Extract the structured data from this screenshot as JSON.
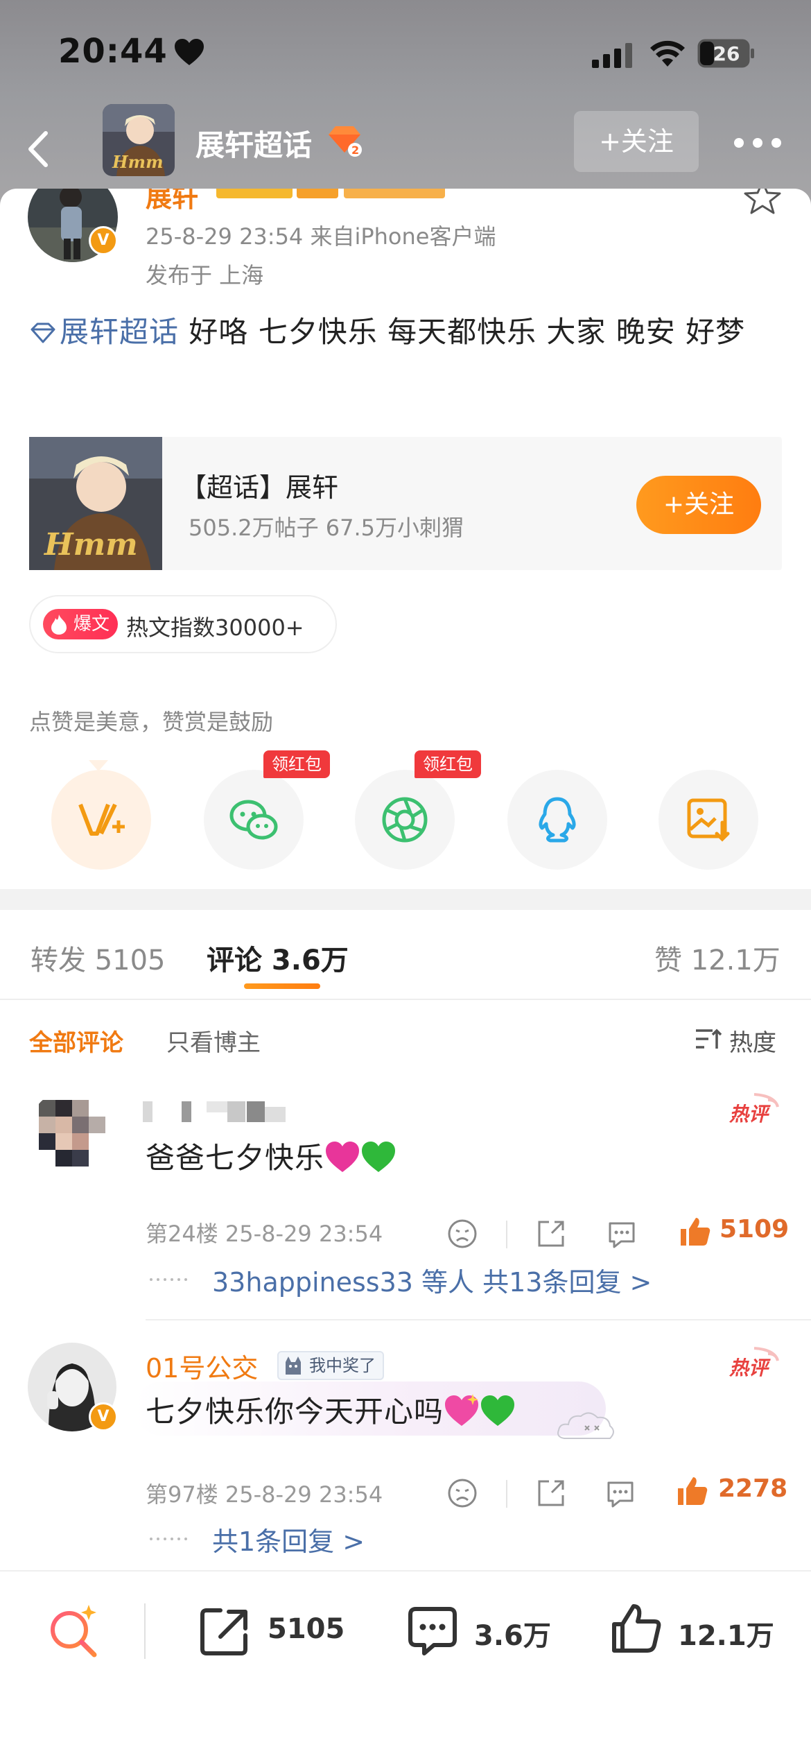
{
  "status_bar": {
    "time": "20:44",
    "battery": "26"
  },
  "nav": {
    "title": "展轩超话",
    "follow_label": "+关注"
  },
  "post": {
    "author": "展轩",
    "time_source": "25-8-29 23:54  来自iPhone客户端",
    "location": "发布于 上海",
    "topic": "展轩超话",
    "text": " 好咯 七夕快乐 每天都快乐 大家 晚安 好梦"
  },
  "topic_card": {
    "title": "【超话】展轩",
    "stats": "505.2万帖子  67.5万小刺猬",
    "follow_label": "+关注"
  },
  "hot": {
    "badge": "爆文",
    "text": "热文指数30000+"
  },
  "reward": {
    "caption": "点赞是美意，赞赏是鼓励",
    "red_tag_1": "领红包",
    "red_tag_2": "领红包"
  },
  "tabs": {
    "repost": "转发 5105",
    "comment": "评论 3.6万",
    "like": "赞 12.1万"
  },
  "filter": {
    "all": "全部评论",
    "owner": "只看博主",
    "sort": "热度"
  },
  "comments": [
    {
      "name": "",
      "text": "爸爸七夕快乐",
      "meta": "第24楼 25-8-29 23:54",
      "likes": "5109",
      "replies_users": "33happiness33",
      "replies_text": " 等人  共13条回复 >"
    },
    {
      "name": "01号公交",
      "badge": "我中奖了",
      "text": "七夕快乐你今天开心吗",
      "meta": "第97楼 25-8-29 23:54",
      "likes": "2278",
      "replies_text": "共1条回复 >"
    }
  ],
  "bottom_bar": {
    "reposts": "5105",
    "comments": "3.6万",
    "likes": "12.1万"
  },
  "colors": {
    "accent": "#f07a12",
    "link": "#4a6fa8",
    "red": "#f0393c"
  }
}
